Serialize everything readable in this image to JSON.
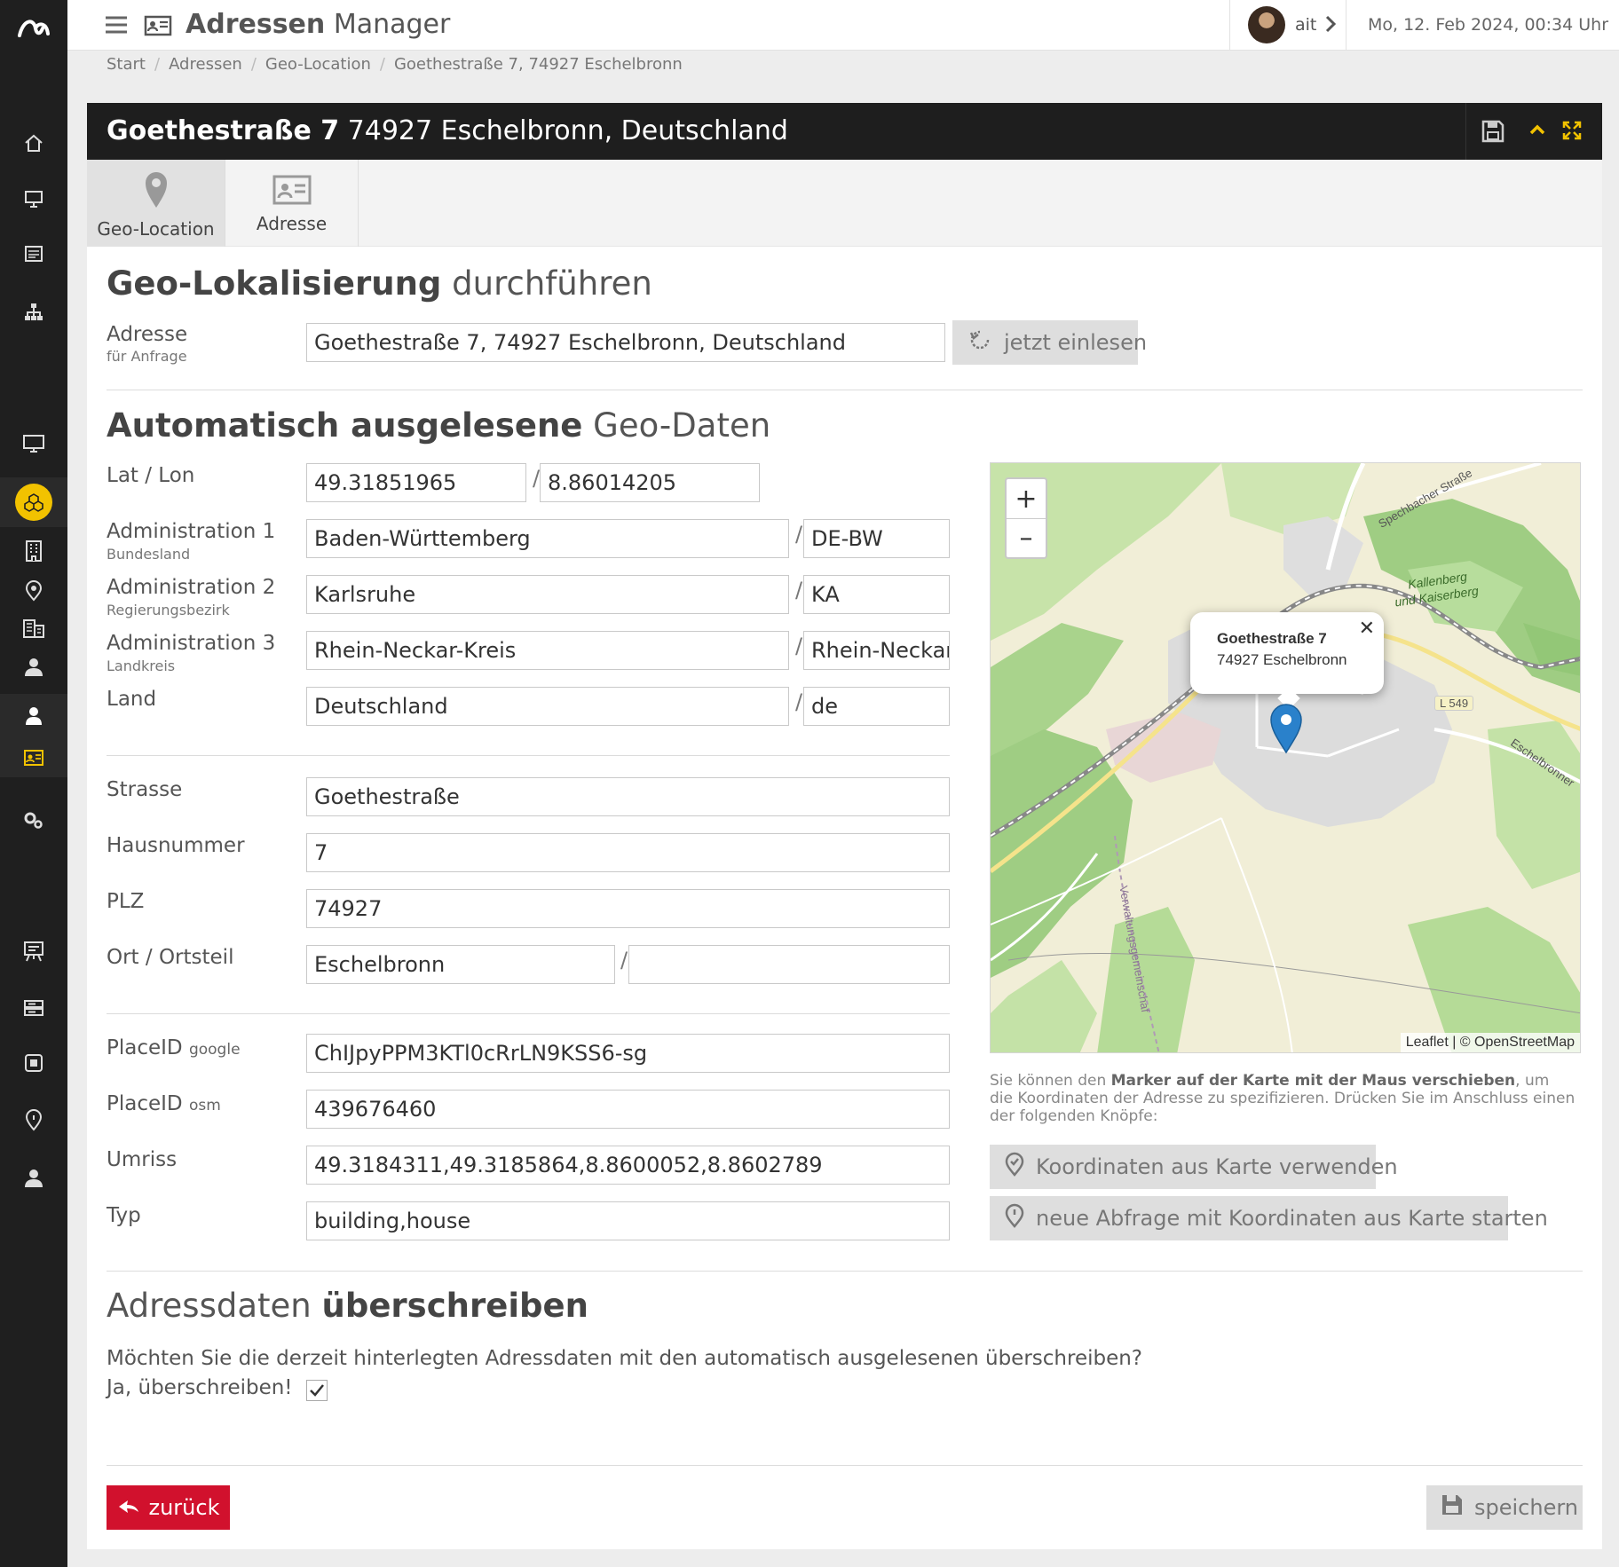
{
  "app": {
    "title_bold": "Adressen",
    "title_rest": "Manager",
    "user": "ait",
    "datetime": "Mo, 12. Feb 2024, 00:34 Uhr"
  },
  "breadcrumb": [
    "Start",
    "Adressen",
    "Geo-Location",
    "Goethestraße 7, 74927 Eschelbronn"
  ],
  "panel": {
    "title_bold": "Goethestraße 7",
    "title_rest": "74927 Eschelbronn, Deutschland"
  },
  "tabs": [
    {
      "label": "Geo-Location",
      "icon": "map-pin-icon",
      "active": true
    },
    {
      "label": "Adresse",
      "icon": "address-card-icon",
      "active": false
    }
  ],
  "geo": {
    "heading_bold": "Geo-Lokalisierung",
    "heading_rest": "durchführen",
    "adresse_label": "Adresse",
    "adresse_sublabel": "für Anfrage",
    "adresse_value": "Goethestraße 7, 74927 Eschelbronn, Deutschland",
    "read_button": "jetzt einlesen"
  },
  "auto": {
    "heading_bold": "Automatisch ausgelesene",
    "heading_rest": "Geo-Daten",
    "latlon_label": "Lat / Lon",
    "lat": "49.31851965",
    "lon": "8.86014205",
    "admin1_label": "Administration 1",
    "admin1_sublabel": "Bundesland",
    "admin1_value": "Baden-Württemberg",
    "admin1_code": "DE-BW",
    "admin2_label": "Administration 2",
    "admin2_sublabel": "Regierungsbezirk",
    "admin2_value": "Karlsruhe",
    "admin2_code": "KA",
    "admin3_label": "Administration 3",
    "admin3_sublabel": "Landkreis",
    "admin3_value": "Rhein-Neckar-Kreis",
    "admin3_code": "Rhein-Neckar-",
    "land_label": "Land",
    "land_value": "Deutschland",
    "land_code": "de",
    "strasse_label": "Strasse",
    "strasse_value": "Goethestraße",
    "hausnummer_label": "Hausnummer",
    "hausnummer_value": "7",
    "plz_label": "PLZ",
    "plz_value": "74927",
    "ort_label": "Ort / Ortsteil",
    "ort_value": "Eschelbronn",
    "ortsteil_value": "",
    "placeid_label": "PlaceID",
    "placeid_google_suffix": "google",
    "placeid_google_value": "ChIJpyPPM3KTl0cRrLN9KSS6-sg",
    "placeid_osm_suffix": "osm",
    "placeid_osm_value": "439676460",
    "umriss_label": "Umriss",
    "umriss_value": "49.3184311,49.3185864,8.8600052,8.8602789",
    "typ_label": "Typ",
    "typ_value": "building,house"
  },
  "map": {
    "popup_line1": "Goethestraße 7",
    "popup_line2": "74927 Eschelbronn",
    "zoom_in": "+",
    "zoom_out": "–",
    "attribution": "Leaflet | © OpenStreetMap",
    "labels": {
      "road1": "Spechbacher Straße",
      "area1": "Kallenberg",
      "area2": "und Kaiserberg",
      "road2": "L 549",
      "road3": "Eschelbronner",
      "road4": "Verwaltungsgemeinschaf"
    },
    "help_pre": "Sie können den",
    "help_bold": "Marker auf der Karte mit der Maus verschieben",
    "help_post": ", um die Koordinaten der Adresse zu spezifizieren. Drücken Sie im Anschluss einen der folgenden Knöpfe:",
    "btn_use": "Koordinaten aus Karte verwenden",
    "btn_query": "neue Abfrage mit Koordinaten aus Karte starten"
  },
  "overwrite": {
    "heading_thin": "Adressdaten",
    "heading_bold": "überschreiben",
    "question": "Möchten Sie die derzeit hinterlegten Adressdaten mit den automatisch ausgelesenen überschreiben?",
    "checkbox_label": "Ja, überschreiben!",
    "checked": true
  },
  "footer": {
    "back": "zurück",
    "save": "speichern"
  },
  "colors": {
    "accent_yellow": "#f2c200",
    "back_red": "#d1112d",
    "marker_blue": "#2a81cb"
  }
}
